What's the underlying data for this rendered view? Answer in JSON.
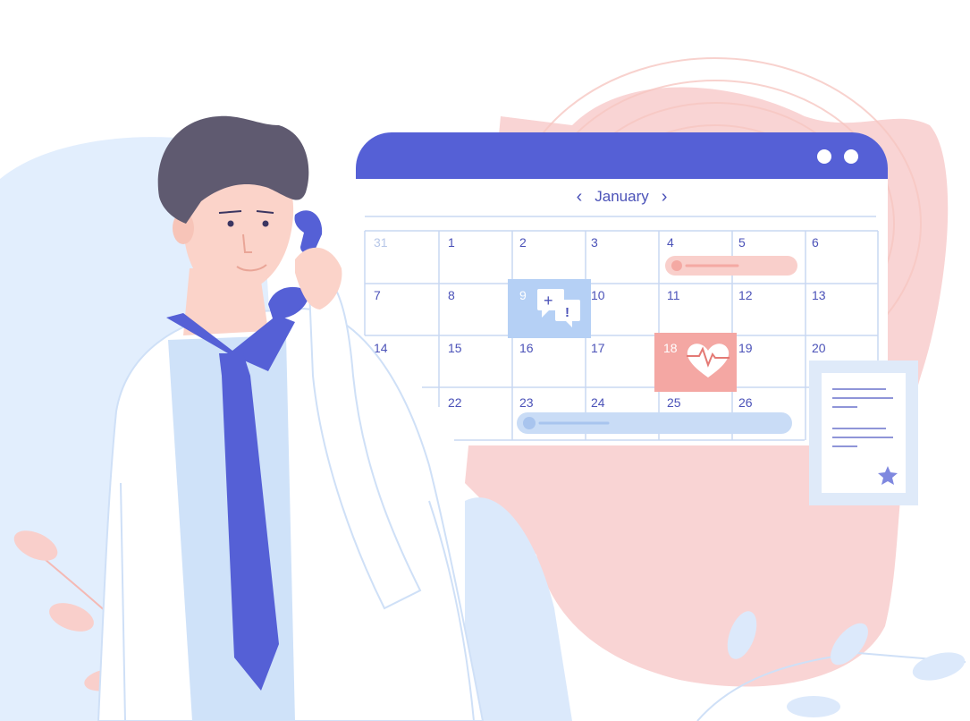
{
  "calendar": {
    "month": "January",
    "prev_icon": "chevron-left-icon",
    "next_icon": "chevron-right-icon",
    "weeks": [
      [
        "31",
        "1",
        "2",
        "3",
        "4",
        "5",
        "6"
      ],
      [
        "7",
        "8",
        "9",
        "10",
        "11",
        "12",
        "13"
      ],
      [
        "14",
        "15",
        "16",
        "17",
        "18",
        "19",
        "20"
      ],
      [
        "",
        "22",
        "23",
        "24",
        "25",
        "26",
        ""
      ]
    ],
    "events": [
      {
        "day": "9",
        "icon": "chat-plus-alert-icon"
      },
      {
        "day": "18",
        "icon": "heart-pulse-icon"
      }
    ]
  },
  "colors": {
    "accent": "#5560d6",
    "pink": "#f9d4d4",
    "light_blue": "#dbe9fb",
    "text": "#4b52b8"
  }
}
